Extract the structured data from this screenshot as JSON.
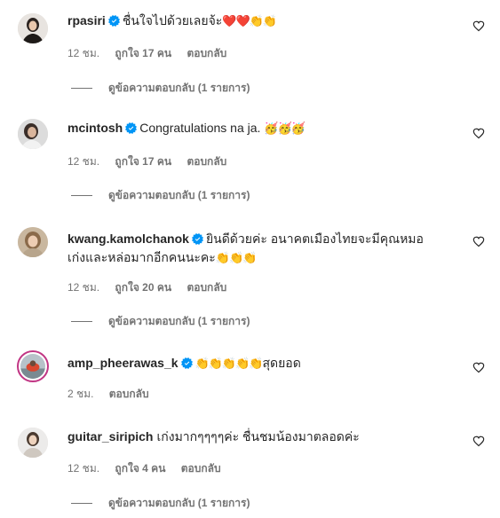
{
  "comments": [
    {
      "username": "rpasiri",
      "text": "ชื่นใจไปด้วยเลยจ้ะ",
      "emoji": "❤️❤️👏👏",
      "time": "12 ชม.",
      "likes": "ถูกใจ 17 คน",
      "reply": "ตอบกลับ",
      "view_replies": "ดูข้อความตอบกลับ (1 รายการ)"
    },
    {
      "username": "mcintosh",
      "text": "Congratulations na ja.",
      "emoji": "🥳🥳🥳",
      "time": "12 ชม.",
      "likes": "ถูกใจ 17 คน",
      "reply": "ตอบกลับ",
      "view_replies": "ดูข้อความตอบกลับ (1 รายการ)"
    },
    {
      "username": "kwang.kamolchanok",
      "text_line1": "ยินดีด้วยค่ะ อนาคตเมืองไทยจะมีคุณหมอ",
      "text_line2": "เก่งและหล่อมากอีกคนนะคะ",
      "emoji": "👏👏👏",
      "time": "12 ชม.",
      "likes": "ถูกใจ 20 คน",
      "reply": "ตอบกลับ",
      "view_replies": "ดูข้อความตอบกลับ (1 รายการ)"
    },
    {
      "username": "amp_pheerawas_k",
      "emoji": "👏👏👏👏👏",
      "text": "สุดยอด",
      "time": "2 ชม.",
      "reply": "ตอบกลับ"
    },
    {
      "username": "guitar_siripich",
      "text": "เก่งมากๆๆๆๆค่ะ ชื่นชมน้องมาตลอดค่ะ",
      "time": "12 ชม.",
      "likes": "ถูกใจ 4 คน",
      "reply": "ตอบกลับ",
      "view_replies": "ดูข้อความตอบกลับ (1 รายการ)"
    }
  ],
  "colors": {
    "text": "#262626",
    "secondary": "#737373",
    "verified": "#0095f6",
    "story_ring": "#c13584"
  }
}
